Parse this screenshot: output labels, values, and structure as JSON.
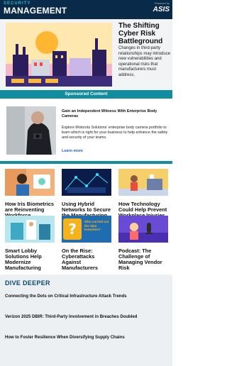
{
  "header": {
    "brand_top": "SECURITY",
    "brand_main": "MANAGEMENT",
    "partner_small": "Powered by",
    "partner": "ASIS"
  },
  "hero": {
    "title": "The Shifting Cyber Risk Battleground",
    "description": "Changes in third-party relationships may introduce new vulnerabilities and operational risks that manufacturers must address."
  },
  "sponsored": {
    "label": "Sponsored Content",
    "title": "Gain an Independent Witness With Enterprise Body Cameras",
    "description": "Explore Motorola Solutions' enterprise body camera portfolio to learn which is right for your business to help enhance the safety and security of your teams.",
    "link": "Learn more"
  },
  "articles": [
    {
      "title": "How Iris Biometrics are Reinventing Workforce Accountability"
    },
    {
      "title": "Using Hybrid Networks to Secure the Manufacturing Floor"
    },
    {
      "title": "How Technology Could Help Prevent Workplace Injuries"
    },
    {
      "title": "Smart Lobby Solutions Help Modernize Manufacturing"
    },
    {
      "title": "On the Rise: Cyberattacks Against Manufacturers",
      "image_text": "Who carried out the data breaches?"
    },
    {
      "title": "Podcast: The Challenge of Managing Vendor Risk"
    }
  ],
  "dive_deeper": {
    "heading": "DIVE DEEPER",
    "links": [
      "Connecting the Dots on Critical Infrastructure Attack Trends",
      "Verizon 2025 DBIR: Third-Party Involvement in Breaches Doubled",
      "How to Foster Resilience When Diversifying Supply Chains"
    ]
  },
  "colors": {
    "header_bg": "#0a2a4a",
    "accent_teal": "#118da0",
    "link_blue": "#1a66c8",
    "dive_heading": "#0a4a72"
  }
}
